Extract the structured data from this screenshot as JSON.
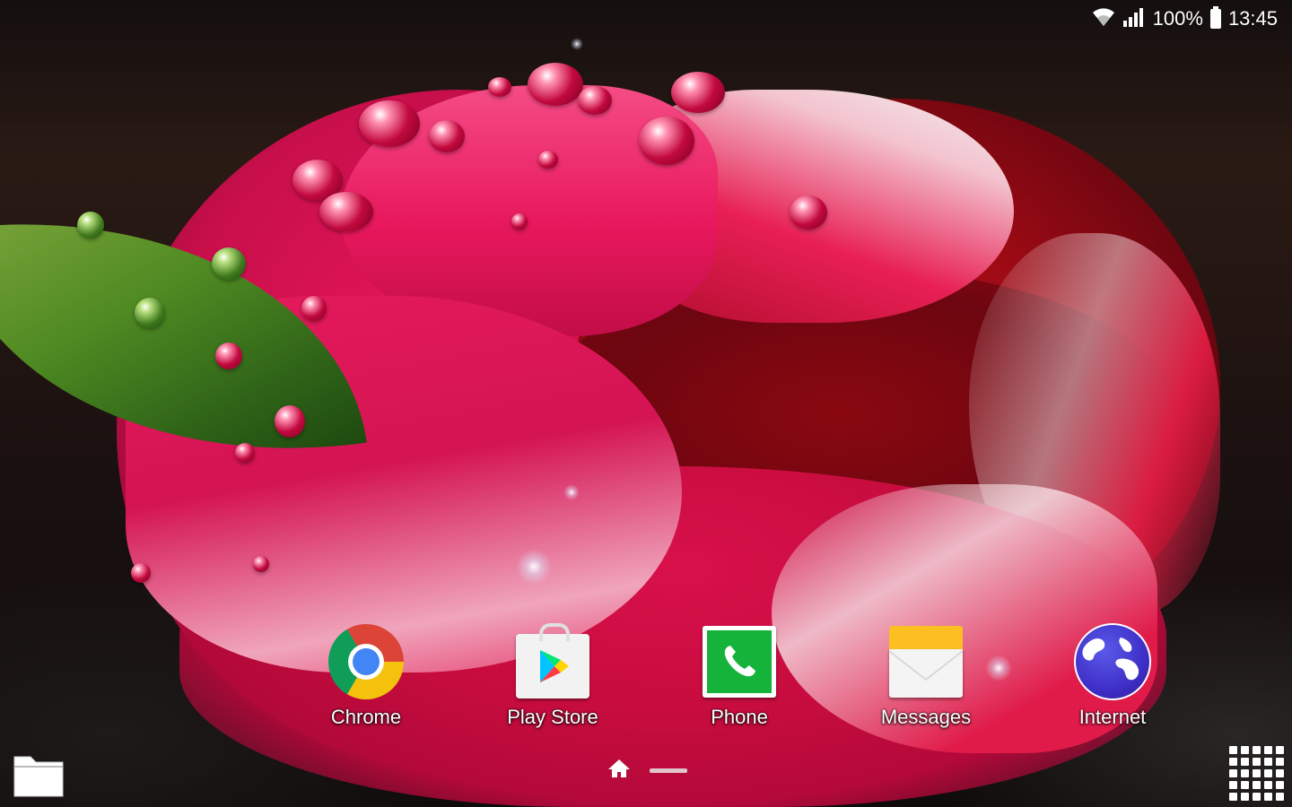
{
  "status_bar": {
    "battery_percent": "100%",
    "time": "13:45",
    "icons": [
      "wifi-icon",
      "signal-icon",
      "battery-icon"
    ]
  },
  "dock": {
    "apps": [
      {
        "label": "Chrome",
        "icon": "chrome-icon"
      },
      {
        "label": "Play Store",
        "icon": "play-store-icon"
      },
      {
        "label": "Phone",
        "icon": "phone-icon"
      },
      {
        "label": "Messages",
        "icon": "messages-icon"
      },
      {
        "label": "Internet",
        "icon": "internet-globe-icon"
      }
    ]
  },
  "bottom_bar": {
    "left_icon": "folder-icon",
    "center_icon": "home-icon",
    "right_icon": "apps-grid-icon"
  },
  "wallpaper": {
    "subject": "tulip-with-water-droplets",
    "colors": {
      "petal": "#e0155a",
      "leaf": "#4f8a22",
      "background": "#140f0f"
    }
  }
}
